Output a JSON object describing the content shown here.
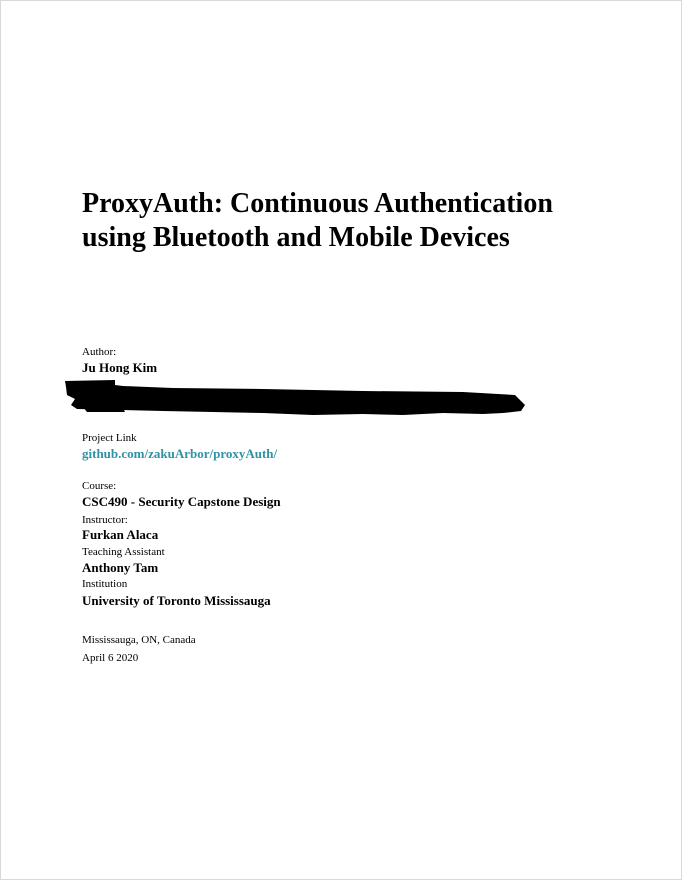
{
  "document": {
    "title_line1": "ProxyAuth: Continuous Authentication",
    "title_line2": "using Bluetooth and Mobile Devices",
    "author_label": "Author:",
    "author_name": "Ju Hong Kim",
    "project_link_label": "Project Link",
    "project_link_value": "github.com/zakuArbor/proxyAuth/",
    "course_label": "Course:",
    "course_value": "CSC490 - Security Capstone Design",
    "instructor_label": "Instructor:",
    "instructor_value": "Furkan Alaca",
    "ta_label": "Teaching Assistant",
    "ta_value": "Anthony Tam",
    "institution_label": "Institution",
    "institution_value": "University of Toronto Mississauga",
    "location": "Mississauga, ON, Canada",
    "date": "April 6 2020"
  },
  "colors": {
    "link": "#2f93a3",
    "redaction": "#000000"
  }
}
